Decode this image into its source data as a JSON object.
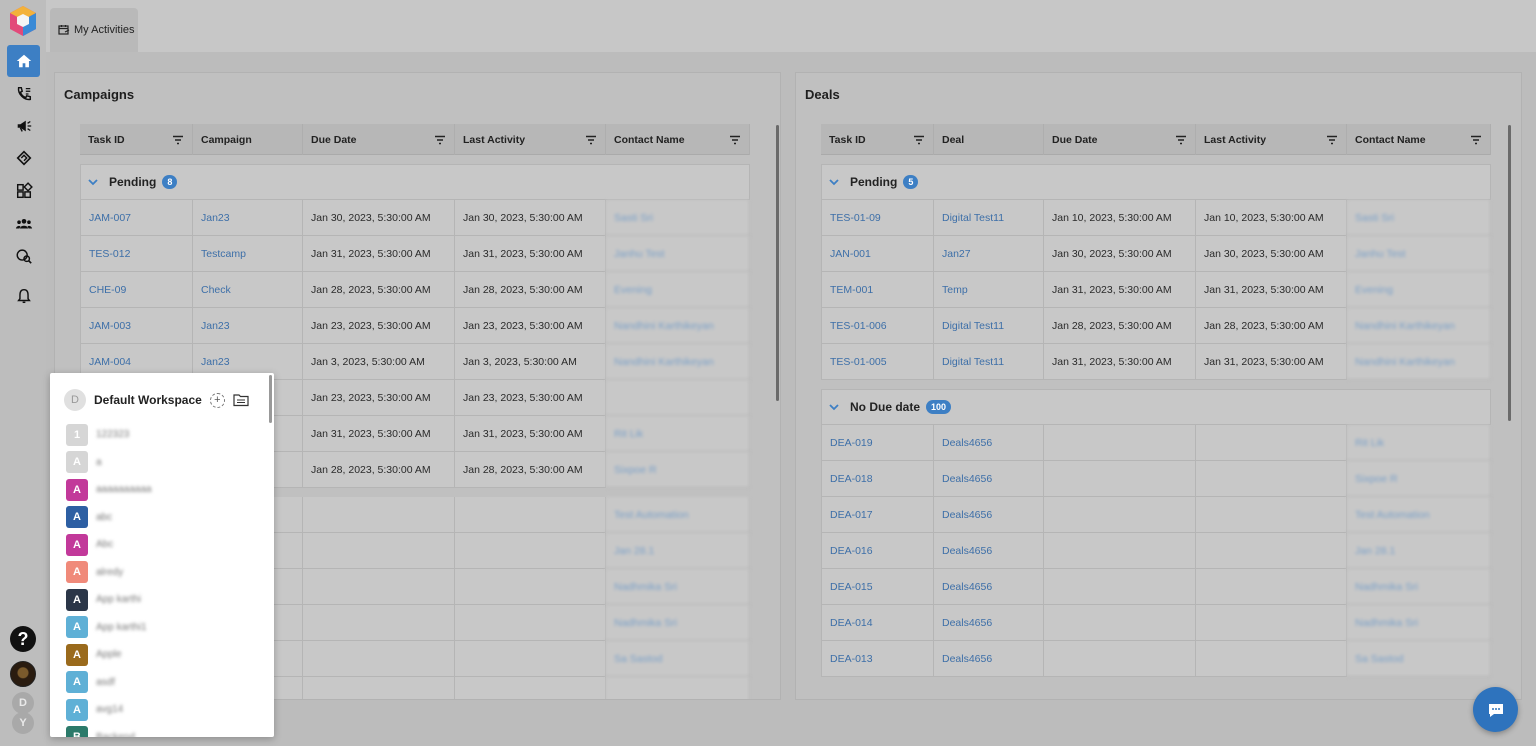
{
  "tab": {
    "label": "My Activities"
  },
  "campaigns": {
    "title": "Campaigns",
    "columns": [
      "Task ID",
      "Campaign",
      "Due Date",
      "Last Activity",
      "Contact Name"
    ],
    "pending": {
      "label": "Pending",
      "count": "8"
    },
    "rows": [
      [
        "JAM-007",
        "Jan23",
        "Jan 30, 2023, 5:30:00 AM",
        "Jan 30, 2023, 5:30:00 AM",
        "Sasti Sri"
      ],
      [
        "TES-012",
        "Testcamp",
        "Jan 31, 2023, 5:30:00 AM",
        "Jan 31, 2023, 5:30:00 AM",
        "Janhu Test"
      ],
      [
        "CHE-09",
        "Check",
        "Jan 28, 2023, 5:30:00 AM",
        "Jan 28, 2023, 5:30:00 AM",
        "Evening"
      ],
      [
        "JAM-003",
        "Jan23",
        "Jan 23, 2023, 5:30:00 AM",
        "Jan 23, 2023, 5:30:00 AM",
        "Nandhini Karthikeyan"
      ],
      [
        "JAM-004",
        "Jan23",
        "Jan 3, 2023, 5:30:00 AM",
        "Jan 3, 2023, 5:30:00 AM",
        "Nandhini Karthikeyan"
      ],
      [
        "",
        "",
        "Jan 23, 2023, 5:30:00 AM",
        "Jan 23, 2023, 5:30:00 AM",
        ""
      ],
      [
        "",
        "",
        "Jan 31, 2023, 5:30:00 AM",
        "Jan 31, 2023, 5:30:00 AM",
        "Rit Lik"
      ],
      [
        "",
        "",
        "Jan 28, 2023, 5:30:00 AM",
        "Jan 28, 2023, 5:30:00 AM",
        "Sixpoe R"
      ]
    ],
    "extra_rows": [
      "Test Automation",
      "Jan 28.1",
      "Nadhmika Sri",
      "Nadhmika Sri",
      "Sa Sastod",
      ""
    ]
  },
  "deals": {
    "title": "Deals",
    "columns": [
      "Task ID",
      "Deal",
      "Due Date",
      "Last Activity",
      "Contact Name"
    ],
    "pending": {
      "label": "Pending",
      "count": "5"
    },
    "rows": [
      [
        "TES-01-09",
        "Digital Test11",
        "Jan 10, 2023, 5:30:00 AM",
        "Jan 10, 2023, 5:30:00 AM",
        "Sasti Sri"
      ],
      [
        "JAN-001",
        "Jan27",
        "Jan 30, 2023, 5:30:00 AM",
        "Jan 30, 2023, 5:30:00 AM",
        "Janhu Test"
      ],
      [
        "TEM-001",
        "Temp",
        "Jan 31, 2023, 5:30:00 AM",
        "Jan 31, 2023, 5:30:00 AM",
        "Evening"
      ],
      [
        "TES-01-006",
        "Digital Test11",
        "Jan 28, 2023, 5:30:00 AM",
        "Jan 28, 2023, 5:30:00 AM",
        "Nandhini Karthikeyan"
      ],
      [
        "TES-01-005",
        "Digital Test11",
        "Jan 31, 2023, 5:30:00 AM",
        "Jan 31, 2023, 5:30:00 AM",
        "Nandhini Karthikeyan"
      ]
    ],
    "no_due": {
      "label": "No Due date",
      "count": "100"
    },
    "no_due_rows": [
      [
        "DEA-019",
        "Deals4656",
        "",
        "",
        "Rit Lik"
      ],
      [
        "DEA-018",
        "Deals4656",
        "",
        "",
        "Sixpoe R"
      ],
      [
        "DEA-017",
        "Deals4656",
        "",
        "",
        "Test Automation"
      ],
      [
        "DEA-016",
        "Deals4656",
        "",
        "",
        "Jan 28.1"
      ],
      [
        "DEA-015",
        "Deals4656",
        "",
        "",
        "Nadhmika Sri"
      ],
      [
        "DEA-014",
        "Deals4656",
        "",
        "",
        "Nadhmika Sri"
      ],
      [
        "DEA-013",
        "Deals4656",
        "",
        "",
        "Sa Sastod"
      ]
    ]
  },
  "workspace": {
    "title": "Default Workspace",
    "initial": "D",
    "add": "+",
    "items": [
      {
        "letter": "1",
        "name": "122323",
        "color": "#d6d6d6"
      },
      {
        "letter": "A",
        "name": "a",
        "color": "#d6d6d6"
      },
      {
        "letter": "A",
        "name": "aaaaaaaaaa",
        "color": "#c2399a"
      },
      {
        "letter": "A",
        "name": "abc",
        "color": "#2d5fa3"
      },
      {
        "letter": "A",
        "name": "Abc",
        "color": "#c2399a"
      },
      {
        "letter": "A",
        "name": "alredy",
        "color": "#f08a7a"
      },
      {
        "letter": "A",
        "name": "App karthi",
        "color": "#2b3648"
      },
      {
        "letter": "A",
        "name": "App karthi1",
        "color": "#5fb0d6"
      },
      {
        "letter": "A",
        "name": "Apple",
        "color": "#9a6a1c"
      },
      {
        "letter": "A",
        "name": "asdf",
        "color": "#5fb0d6"
      },
      {
        "letter": "A",
        "name": "avg14",
        "color": "#5fb0d6"
      },
      {
        "letter": "B",
        "name": "Backend",
        "color": "#2b7a6a"
      }
    ]
  },
  "sidebar": {
    "help": "?",
    "mini1": "D",
    "mini2": "Y"
  }
}
